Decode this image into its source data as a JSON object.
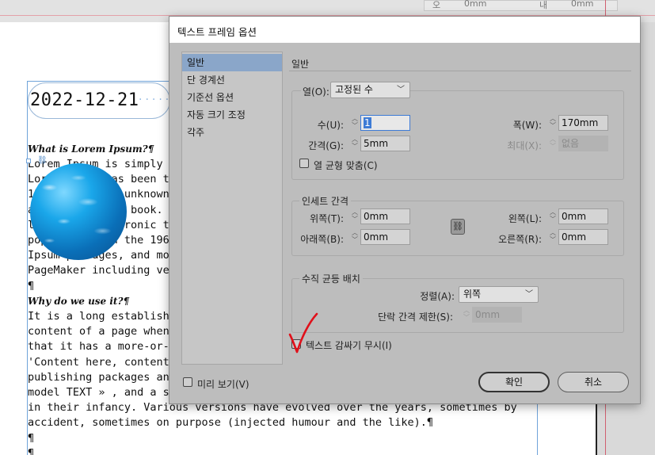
{
  "background": {
    "panel_left_label": "오",
    "panel_left_value": "0mm",
    "panel_right_label": "내",
    "panel_right_value": "0mm",
    "date": "2022-12-21",
    "heading1": "What is Lorem Ipsum?¶",
    "lines1": [
      "Lorem Ipsum is simply d",
      "Lorem Ipsum has been the",
      "1500s, when an unknown ",
      "a type specimen book. I",
      "leap into electronic ty",
      "popularised in the 1960",
      "Ipsum passages, and mor",
      "PageMaker including ver",
      "¶"
    ],
    "heading2": "Why do we use it?¶",
    "lines2": [
      "It is a long establishe",
      "content of a page when ",
      "that it has a more-or-l",
      "'Content here, content ",
      "publishing packages and",
      "model TEXT » , and a sea",
      "in their infancy. Various versions have evolved over the years, sometimes by",
      "accident, sometimes on purpose (injected humour and the like).¶",
      "¶",
      "¶"
    ]
  },
  "dialog": {
    "title": "텍스트 프레임 옵션",
    "nav": [
      "일반",
      "단 경계선",
      "기준선 옵션",
      "자동 크기 조정",
      "각주"
    ],
    "section_title": "일반",
    "columns": {
      "type_label": "열(O):",
      "type_value": "고정된 수",
      "number_label": "수(U):",
      "number_value": "1",
      "gutter_label": "간격(G):",
      "gutter_value": "5mm",
      "width_label": "폭(W):",
      "width_value": "170mm",
      "max_label": "최대(X):",
      "max_value": "없음",
      "balance_label": "열 균형 맞춤(C)"
    },
    "inset": {
      "legend": "인세트 간격",
      "top_label": "위쪽(T):",
      "top_value": "0mm",
      "bottom_label": "아래쪽(B):",
      "bottom_value": "0mm",
      "left_label": "왼쪽(L):",
      "left_value": "0mm",
      "right_label": "오른쪽(R):",
      "right_value": "0mm"
    },
    "vertical": {
      "legend": "수직 균등 배치",
      "align_label": "정렬(A):",
      "align_value": "위쪽",
      "spacing_label": "단락 간격 제한(S):",
      "spacing_value": "0mm"
    },
    "ignore_wrap_label": "텍스트 감싸기 무시(I)",
    "preview_label": "미리 보기(V)",
    "ok_label": "확인",
    "cancel_label": "취소"
  },
  "colors": {
    "nav_selected": "#8aa6c9",
    "annotation_check": "#e0101a",
    "focus_blue": "#3d7bd6"
  }
}
